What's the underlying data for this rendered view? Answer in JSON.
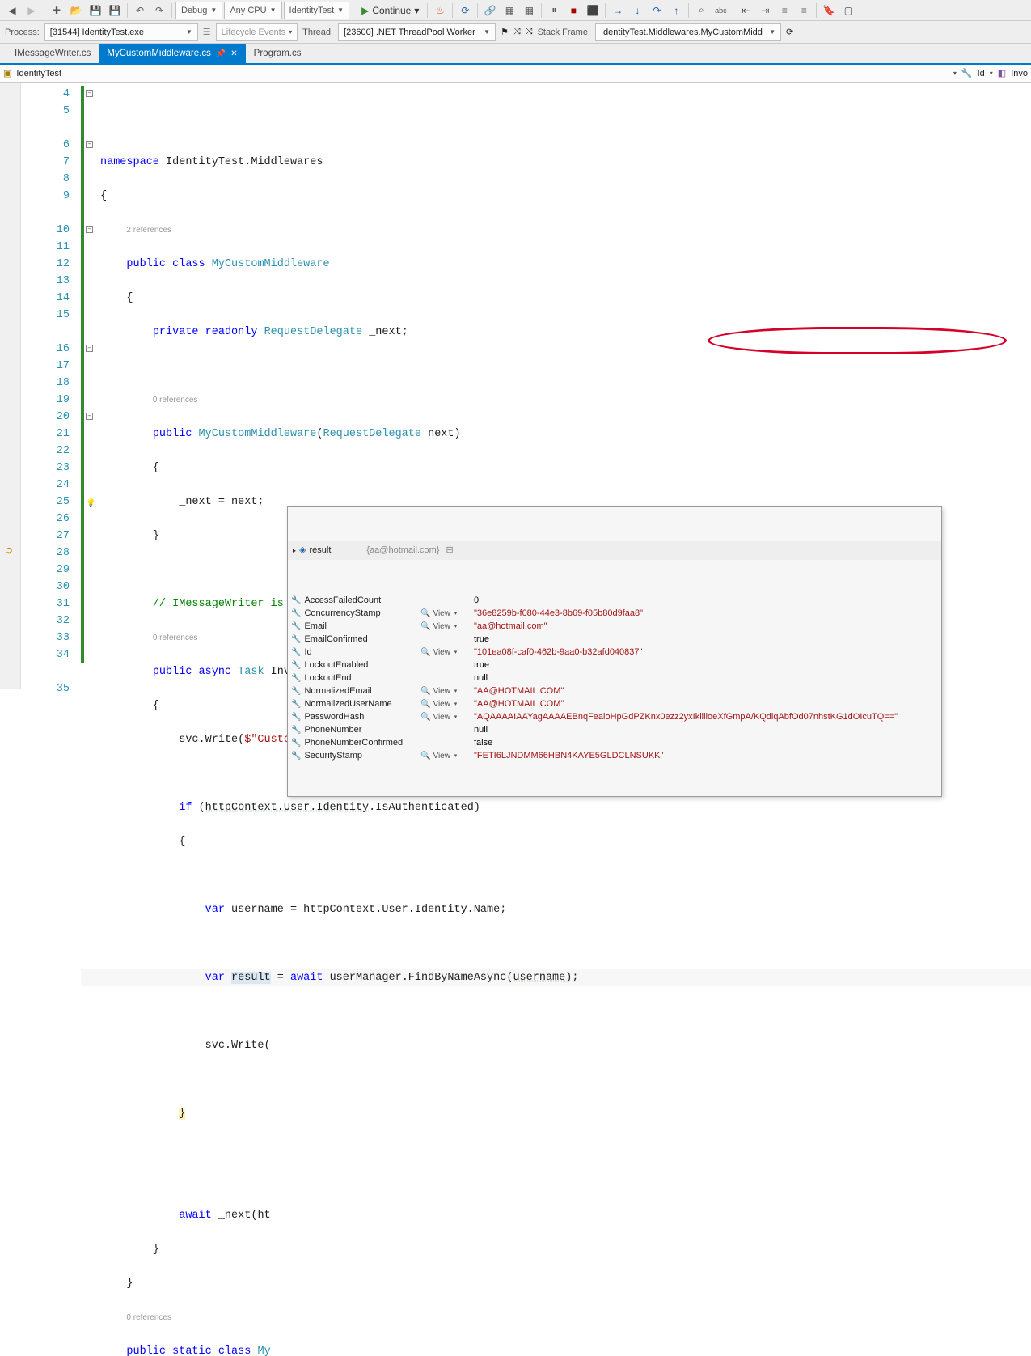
{
  "toolbar": {
    "config": "Debug",
    "platform": "Any CPU",
    "startup": "IdentityTest",
    "continue": "Continue"
  },
  "debugbar": {
    "process_label": "Process:",
    "process_value": "[31544] IdentityTest.exe",
    "lifecycle": "Lifecycle Events",
    "thread_label": "Thread:",
    "thread_value": "[23600] .NET ThreadPool Worker",
    "stackframe_label": "Stack Frame:",
    "stackframe_value": "IdentityTest.Middlewares.MyCustomMidd"
  },
  "tabs": [
    {
      "label": "IMessageWriter.cs",
      "active": false
    },
    {
      "label": "MyCustomMiddleware.cs",
      "active": true
    },
    {
      "label": "Program.cs",
      "active": false
    }
  ],
  "navbar": {
    "namespace": "IdentityTest",
    "member": "Id",
    "right": "Invo"
  },
  "linenums": [
    4,
    5,
    "",
    6,
    7,
    8,
    9,
    "",
    10,
    11,
    12,
    13,
    14,
    15,
    "",
    16,
    17,
    18,
    19,
    20,
    21,
    22,
    23,
    24,
    25,
    26,
    27,
    28,
    29,
    30,
    31,
    32,
    33,
    34,
    "",
    35
  ],
  "code": {
    "refs2": "2 references",
    "refs0a": "0 references",
    "refs0b": "0 references",
    "refs0c": "0 references"
  },
  "tooltip": {
    "result_name": "result",
    "result_hint": "{aa@hotmail.com}",
    "view": "View",
    "props": [
      {
        "name": "AccessFailedCount",
        "view": false,
        "value": "0",
        "str": false
      },
      {
        "name": "ConcurrencyStamp",
        "view": true,
        "value": "\"36e8259b-f080-44e3-8b69-f05b80d9faa8\"",
        "str": true
      },
      {
        "name": "Email",
        "view": true,
        "value": "\"aa@hotmail.com\"",
        "str": true
      },
      {
        "name": "EmailConfirmed",
        "view": false,
        "value": "true",
        "str": false
      },
      {
        "name": "Id",
        "view": true,
        "value": "\"101ea08f-caf0-462b-9aa0-b32afd040837\"",
        "str": true
      },
      {
        "name": "LockoutEnabled",
        "view": false,
        "value": "true",
        "str": false
      },
      {
        "name": "LockoutEnd",
        "view": false,
        "value": "null",
        "str": false
      },
      {
        "name": "NormalizedEmail",
        "view": true,
        "value": "\"AA@HOTMAIL.COM\"",
        "str": true
      },
      {
        "name": "NormalizedUserName",
        "view": true,
        "value": "\"AA@HOTMAIL.COM\"",
        "str": true
      },
      {
        "name": "PasswordHash",
        "view": true,
        "value": "\"AQAAAAIAAYagAAAAEBnqFeaioHpGdPZKnx0ezz2yxIkiiiioeXfGmpA/KQdiqAbfOd07nhstKG1dOIcuTQ==\"",
        "str": true
      },
      {
        "name": "PhoneNumber",
        "view": false,
        "value": "null",
        "str": false
      },
      {
        "name": "PhoneNumberConfirmed",
        "view": false,
        "value": "false",
        "str": false
      },
      {
        "name": "SecurityStamp",
        "view": true,
        "value": "\"FETI6LJNDMM66HBN4KAYE5GLDCLNSUKK\"",
        "str": true
      }
    ]
  }
}
